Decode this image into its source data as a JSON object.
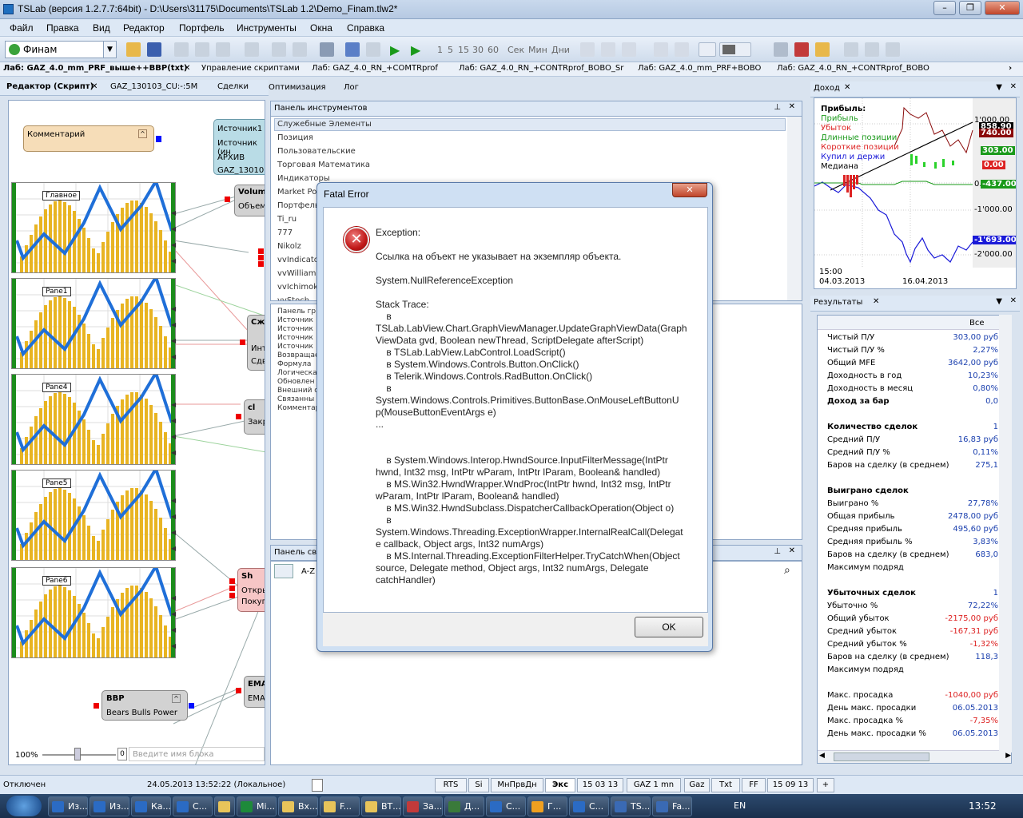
{
  "window": {
    "title": "TSLab (версия 1.2.7.7:64bit) - D:\\Users\\31175\\Documents\\TSLab 1.2\\Demo_Finam.tlw2*"
  },
  "menu": [
    "Файл",
    "Правка",
    "Вид",
    "Редактор",
    "Портфель",
    "Инструменты",
    "Окна",
    "Справка"
  ],
  "toolbar": {
    "broker": "Финам",
    "intervals": [
      "1",
      "5",
      "15",
      "30",
      "60"
    ],
    "units": [
      "Сек",
      "Мин",
      "Дни"
    ]
  },
  "doc_tabs": [
    "Лаб: GAZ_4.0_mm_PRF_выше++BBP(txt)",
    "Управление скриптами",
    "Лаб: GAZ_4.0_RN_+COMTRprof",
    "Лаб: GAZ_4.0_RN_+CONTRprof_BOBO_Sr",
    "Лаб: GAZ_4.0_mm_PRF+BOBO",
    "Лаб: GAZ_4.0_RN_+CONTRprof_BOBO"
  ],
  "editor": {
    "tabs": [
      "Редактор (Скрипт)",
      "GAZ_130103_CU:-:5M",
      "Сделки",
      "Оптимизация",
      "Лог"
    ],
    "comment_block": "Комментарий",
    "source_block": [
      "Источник1",
      "Источник (ин",
      "АРХИВ",
      "GAZ_130103"
    ],
    "panes": [
      "Главное",
      "Pane1",
      "Pane4",
      "Pane5",
      "Pane6"
    ],
    "nodes": {
      "volume_title": "Volum",
      "volume_sub": "Объем",
      "sj_title": "Сж",
      "sj_sub1": "Инте",
      "sj_sub2": "Сдви",
      "cl_title": "cl",
      "cl_sub": "Закр",
      "sh_title": "Sh",
      "sh_sub1": "Откры",
      "sh_sub2": "Покупк",
      "bbp_title": "BBP",
      "bbp_sub": "Bears Bulls Power",
      "ema_title": "EMA",
      "ema_sub": "EMA"
    },
    "zoom": "100%",
    "zoom_value": "0",
    "block_placeholder": "Введите имя блока"
  },
  "tools": {
    "header": "Панель инструментов",
    "items": [
      "Служебные Элементы",
      "Позиция",
      "Пользовательские",
      "Торговая Математика",
      "Индикаторы",
      "Market Pos",
      "Портфель",
      "Ti_ru",
      "777",
      "Nikolz",
      "vvIndicato",
      "vvWilliams",
      "vvIchimok",
      "vvStoch"
    ],
    "subitems": [
      "Панель гр",
      "Источник",
      "Источник",
      "Источник",
      "Источник",
      "Возвращае",
      "Формула",
      "Логическа",
      "Обновлен",
      "Внешний с",
      "Связанны",
      "Комментар"
    ],
    "props_header": "Панель сво",
    "props_sort": "A-Z"
  },
  "dialog": {
    "title": "Fatal Error",
    "message": "Exception:\n\nСсылка на объект не указывает на экземпляр объекта.\n\nSystem.NullReferenceException\n\nStack Trace:\n    в\nTSLab.LabView.Chart.GraphViewManager.UpdateGraphViewData(Graph\nViewData gvd, Boolean newThread, ScriptDelegate afterScript)\n    в TSLab.LabView.LabControl.LoadScript()\n    в System.Windows.Controls.Button.OnClick()\n    в Telerik.Windows.Controls.RadButton.OnClick()\n    в\nSystem.Windows.Controls.Primitives.ButtonBase.OnMouseLeftButtonU\np(MouseButtonEventArgs e)\n...\n\n\n    в System.Windows.Interop.HwndSource.InputFilterMessage(IntPtr\nhwnd, Int32 msg, IntPtr wParam, IntPtr lParam, Boolean& handled)\n    в MS.Win32.HwndWrapper.WndProc(IntPtr hwnd, Int32 msg, IntPtr\nwParam, IntPtr lParam, Boolean& handled)\n    в MS.Win32.HwndSubclass.DispatcherCallbackOperation(Object o)\n    в\nSystem.Windows.Threading.ExceptionWrapper.InternalRealCall(Delegat\ne callback, Object args, Int32 numArgs)\n    в MS.Internal.Threading.ExceptionFilterHelper.TryCatchWhen(Object\nsource, Delegate method, Object args, Int32 numArgs, Delegate\ncatchHandler)",
    "ok": "OK"
  },
  "income": {
    "tab": "Доход",
    "legend": [
      "Прибыль:",
      "Прибыль",
      "Убыток",
      "Длинные позиции",
      "Короткие позиции",
      "Купил и держи",
      "Медиана"
    ],
    "y_labels": [
      "1'000.00",
      "0.00",
      "-1'000.00",
      "-2'000.00"
    ],
    "value_tags": [
      "858.90",
      "740.00",
      "303.00",
      "0.00",
      "-437.00",
      "-1'693.00"
    ],
    "time": "15:00",
    "dates": [
      "04.03.2013",
      "16.04.2013"
    ]
  },
  "results": {
    "tab": "Результаты",
    "col": "Все",
    "rows": [
      {
        "k": "Чистый П/У",
        "v": "303,00 руб"
      },
      {
        "k": "Чистый П/У %",
        "v": "2,27%"
      },
      {
        "k": "Общий MFE",
        "v": "3642,00 руб"
      },
      {
        "k": "Доходность в год",
        "v": "10,23%"
      },
      {
        "k": "Доходность в месяц",
        "v": "0,80%"
      },
      {
        "k": "Доход за бар",
        "v": "0,0"
      },
      {
        "k": "Количество сделок",
        "v": "1"
      },
      {
        "k": "Средний П/У",
        "v": "16,83 руб"
      },
      {
        "k": "Средний П/У %",
        "v": "0,11%"
      },
      {
        "k": "Баров на сделку (в среднем)",
        "v": "275,1"
      },
      {
        "k": "Выиграно сделок",
        "v": ""
      },
      {
        "k": "Выиграно %",
        "v": "27,78%"
      },
      {
        "k": "Общая прибыль",
        "v": "2478,00 руб"
      },
      {
        "k": "Средняя прибыль",
        "v": "495,60 руб"
      },
      {
        "k": "Средняя прибыль %",
        "v": "3,83%"
      },
      {
        "k": "Баров на сделку (в среднем)",
        "v": "683,0"
      },
      {
        "k": "Максимум подряд",
        "v": ""
      },
      {
        "k": "Убыточных сделок",
        "v": "1"
      },
      {
        "k": "Убыточно %",
        "v": "72,22%"
      },
      {
        "k": "Общий убыток",
        "v": "-2175,00 руб"
      },
      {
        "k": "Средний убыток",
        "v": "-167,31 руб"
      },
      {
        "k": "Средний убыток %",
        "v": "-1,32%"
      },
      {
        "k": "Баров на сделку (в среднем)",
        "v": "118,3"
      },
      {
        "k": "Максимум подряд",
        "v": ""
      },
      {
        "k": "Макс. просадка",
        "v": "-1040,00 руб"
      },
      {
        "k": "День макс. просадки",
        "v": "06.05.2013"
      },
      {
        "k": "Макс. просадка %",
        "v": "-7,35%"
      },
      {
        "k": "День макс. просадки %",
        "v": "06.05.2013"
      }
    ]
  },
  "status": {
    "conn": "Отключен",
    "time": "24.05.2013 13:52:22 (Локальное)",
    "tabs": [
      "RTS",
      "Si",
      "МнПрвДн",
      "Экс",
      "15 03 13",
      "GAZ 1 mn",
      "Gaz",
      "Txt",
      "FF",
      "15 09 13",
      "+"
    ]
  },
  "taskbar": {
    "buttons": [
      "Из...",
      "Из...",
      "Ка...",
      "С...",
      "",
      "Mi...",
      "Вх...",
      "F...",
      "ВТ...",
      "За...",
      "Д...",
      "С...",
      "Г...",
      "С...",
      "TS...",
      "Fa..."
    ],
    "lang": "EN",
    "clock": "13:52"
  }
}
